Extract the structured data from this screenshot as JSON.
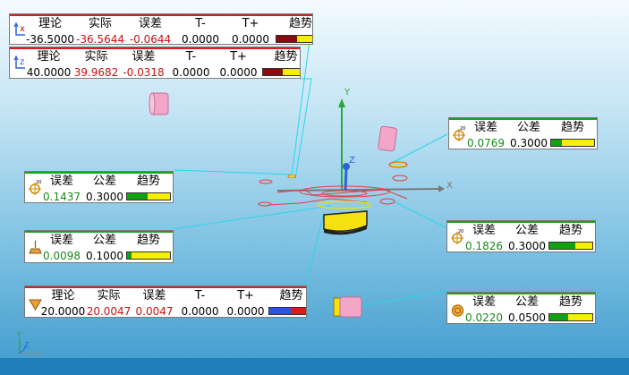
{
  "colors": {
    "leader": "#29d6ea",
    "axis_x": "#7a7a7a",
    "axis_y": "#2ea83a",
    "feature": "#e04040",
    "highlight": "#f2e000"
  },
  "panels": {
    "x_dev": {
      "icon": "x-axis-deviation-icon",
      "headers": [
        "理论",
        "实际",
        "误差",
        "T-",
        "T+",
        "趋势"
      ],
      "values": [
        "-36.5000",
        "-36.5644",
        "-0.0644",
        "0.0000",
        "0.0000"
      ],
      "trend": {
        "fill": 0.45,
        "fill_color": "#8a0b0b",
        "rest_color": "#f5f000"
      }
    },
    "z_dev": {
      "icon": "z-axis-deviation-icon",
      "headers": [
        "理论",
        "实际",
        "误差",
        "T-",
        "T+",
        "趋势"
      ],
      "values": [
        "40.0000",
        "39.9682",
        "-0.0318",
        "0.0000",
        "0.0000"
      ],
      "trend": {
        "fill": 0.45,
        "fill_color": "#8a0b0b",
        "rest_color": "#f5f000"
      }
    },
    "pos_right_1": {
      "icon": "position-tolerance-icon",
      "icon_label": "20",
      "headers": [
        "误差",
        "公差",
        "趋势"
      ],
      "values": [
        "0.0769",
        "0.3000"
      ],
      "trend": {
        "fill": 0.26
      }
    },
    "pos_left": {
      "icon": "position-tolerance-icon",
      "icon_label": "20",
      "headers": [
        "误差",
        "公差",
        "趋势"
      ],
      "values": [
        "0.1437",
        "0.3000"
      ],
      "trend": {
        "fill": 0.48
      }
    },
    "pos_right_2": {
      "icon": "position-tolerance-icon",
      "icon_label": "20",
      "headers": [
        "误差",
        "公差",
        "趋势"
      ],
      "values": [
        "0.1826",
        "0.3000"
      ],
      "trend": {
        "fill": 0.61
      }
    },
    "flatness": {
      "icon": "flatness-icon",
      "headers": [
        "误差",
        "公差",
        "趋势"
      ],
      "values": [
        "0.0098",
        "0.1000"
      ],
      "trend": {
        "fill": 0.1
      }
    },
    "diameter": {
      "icon": "diameter-icon",
      "headers": [
        "理论",
        "实际",
        "误差",
        "T-",
        "T+",
        "趋势"
      ],
      "values": [
        "20.0000",
        "20.0047",
        "0.0047",
        "0.0000",
        "0.0000"
      ],
      "trend": {
        "fill": 0.5
      }
    },
    "circularity": {
      "icon": "circularity-icon",
      "headers": [
        "误差",
        "公差",
        "趋势"
      ],
      "values": [
        "0.0220",
        "0.0500"
      ],
      "trend": {
        "fill": 0.44
      }
    }
  },
  "scene": {
    "x_axis_label": "X",
    "y_axis_label": "Y",
    "z_axis_label": "Z"
  },
  "triad": {
    "x_label": "X",
    "y_label": "Y",
    "z_label": "Z"
  }
}
